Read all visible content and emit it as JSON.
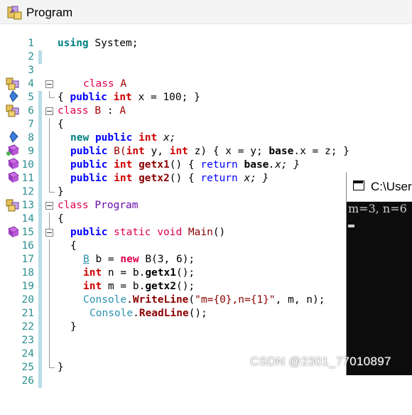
{
  "window": {
    "title": "Program",
    "icon": "csharp-project-icon"
  },
  "editor": {
    "lines": [
      {
        "num": "1"
      },
      {
        "num": "2"
      },
      {
        "num": "3"
      },
      {
        "num": "4"
      },
      {
        "num": "5"
      },
      {
        "num": "6"
      },
      {
        "num": "7"
      },
      {
        "num": "8"
      },
      {
        "num": "9"
      },
      {
        "num": "10"
      },
      {
        "num": "11"
      },
      {
        "num": "12"
      },
      {
        "num": "13"
      },
      {
        "num": "14"
      },
      {
        "num": "15"
      },
      {
        "num": "16"
      },
      {
        "num": "17"
      },
      {
        "num": "18"
      },
      {
        "num": "19"
      },
      {
        "num": "20"
      },
      {
        "num": "21"
      },
      {
        "num": "22"
      },
      {
        "num": "23"
      },
      {
        "num": "24"
      },
      {
        "num": "25"
      },
      {
        "num": "26"
      }
    ],
    "t": {
      "using": "using",
      "system": " System;",
      "class": "class",
      "A": " A",
      "B": " B",
      "colon": " : ",
      "Aref": "A",
      "open_brace": "{",
      "close_brace": "}",
      "lbrace_sp": "{ ",
      "public": "public",
      "int": "int",
      "x_eq_100": " x = 100; }",
      "new": "new",
      "x_semicolon": " x;",
      "ctor_B": " B(",
      "int2": "int",
      "y_comma": " y, ",
      "int3": "int",
      "z_close": " z) { x = y; ",
      "base": "base",
      "dot_x_eq_z": ".x = z; }",
      "getx1": "getx1",
      "getx2": "getx2",
      "paren_open": "() { ",
      "return": "return",
      "base_x": " base",
      "dot_x_semi_close": ".x; }",
      "x_semi_close": " x; }",
      "Program": " Program",
      "static": "static",
      "void": "void",
      "Main": " Main",
      "main_parens": "()",
      "B_type": "B",
      "b_eq_new": " b = ",
      "new_B": "new",
      "B_ctor_args": " B(3, 6);",
      "n_eq": " n = b.",
      "m_eq": " m = b.",
      "getx1_call": "getx1",
      "getx2_call": "getx2",
      "call_end": "();",
      "Console": "Console",
      "dot": ".",
      "WriteLine": "WriteLine",
      "paren": "(",
      "fmt": "\"m={0},n={1}\"",
      "args_end": ", m, n);",
      "ReadLine": "ReadLine",
      "readline_end": "();"
    }
  },
  "console": {
    "title": "C:\\Users",
    "output": "m=3, n=6"
  },
  "watermark": "CSDN @2301_77010897"
}
